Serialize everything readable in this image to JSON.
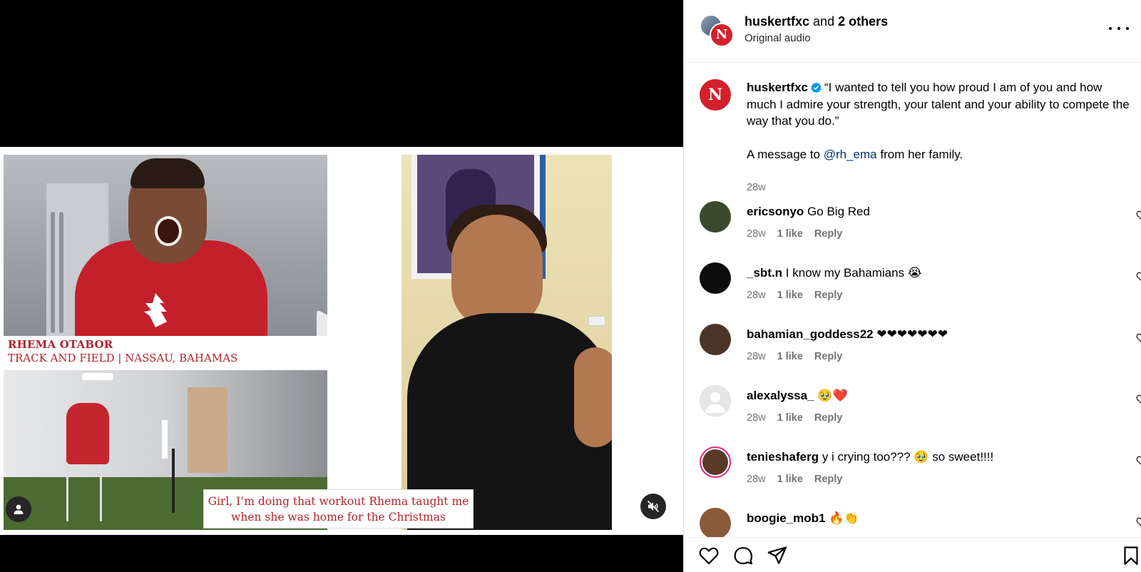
{
  "media": {
    "title_card": {
      "name": "RHEMA OTABOR",
      "subtitle": "TRACK AND FIELD | NASSAU, BAHAMAS"
    },
    "caption_lines": [
      "Girl, I’m doing that workout Rhema taught me",
      "when she was home for the Christmas"
    ],
    "icons": {
      "play": "play-icon",
      "user_tag": "user-icon",
      "mute": "muted-speaker-icon"
    }
  },
  "header": {
    "username": "huskertfxc",
    "joiner": " and ",
    "others": "2 others",
    "audio": "Original audio",
    "badge_letter": "N"
  },
  "caption": {
    "username": "huskertfxc",
    "text_line1": "“I wanted to tell you how proud I am of you and how much I admire your strength, your talent and your ability to compete the way that you do.”",
    "text_pre": "A message to ",
    "mention": "@rh_ema",
    "text_post": " from her family.",
    "time": "28w"
  },
  "comments": [
    {
      "username": "ericsonyo",
      "text": "Go Big Red",
      "time": "28w",
      "likes": "1 like",
      "reply": "Reply",
      "avatar_color": "#3b4a2c"
    },
    {
      "username": "_sbt.n",
      "text": "I know my Bahamians 😭",
      "time": "28w",
      "likes": "1 like",
      "reply": "Reply",
      "avatar_color": "#0d0d0d"
    },
    {
      "username": "bahamian_goddess22",
      "text": "❤❤❤❤❤❤❤",
      "time": "28w",
      "likes": "1 like",
      "reply": "Reply",
      "avatar_color": "#4b3526"
    },
    {
      "username": "alexalyssa_",
      "text": "🥹❤️",
      "time": "28w",
      "likes": "1 like",
      "reply": "Reply",
      "avatar_color": "#e6e6e6"
    },
    {
      "username": "tenieshaferg",
      "text": "y i crying too??? 🥹 so sweet!!!!",
      "time": "28w",
      "likes": "1 like",
      "reply": "Reply",
      "avatar_color": "#5a3b2a"
    },
    {
      "username": "boogie_mob1",
      "text": "🔥👏",
      "time": "",
      "likes": "",
      "reply": "",
      "avatar_color": "#8a5a3a"
    }
  ],
  "colors": {
    "nebraska_red": "#d41f2c",
    "caption_red": "#b1232d",
    "mention_blue": "#00376b",
    "muted_gray": "#737373",
    "verified_blue": "#0095f6"
  },
  "footer_icons": [
    "heart-icon",
    "comment-icon",
    "share-icon",
    "bookmark-icon"
  ]
}
